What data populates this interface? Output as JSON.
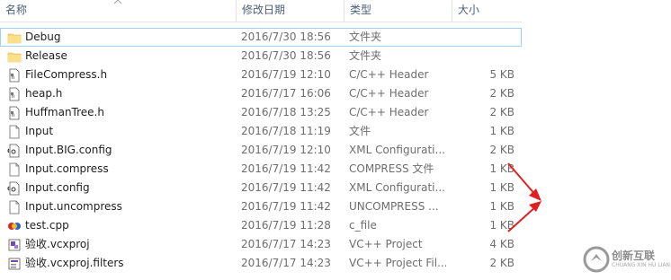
{
  "columns": {
    "name": "名称",
    "date": "修改日期",
    "type": "类型",
    "size": "大小"
  },
  "files": [
    {
      "name": "Debug",
      "date": "2016/7/30 18:56",
      "type": "文件夹",
      "size": "",
      "icon": "folder-icon"
    },
    {
      "name": "Release",
      "date": "2016/7/30 18:56",
      "type": "文件夹",
      "size": "",
      "icon": "folder-icon"
    },
    {
      "name": "FileCompress.h",
      "date": "2016/7/19 12:10",
      "type": "C/C++ Header",
      "size": "5 KB",
      "icon": "header-file-icon"
    },
    {
      "name": "heap.h",
      "date": "2016/7/17 16:06",
      "type": "C/C++ Header",
      "size": "2 KB",
      "icon": "header-file-icon"
    },
    {
      "name": "HuffmanTree.h",
      "date": "2016/7/18 13:25",
      "type": "C/C++ Header",
      "size": "2 KB",
      "icon": "header-file-icon"
    },
    {
      "name": "Input",
      "date": "2016/7/18 11:19",
      "type": "文件",
      "size": "1 KB",
      "icon": "blank-file-icon"
    },
    {
      "name": "Input.BIG.config",
      "date": "2016/7/19 12:10",
      "type": "XML Configurati...",
      "size": "2 KB",
      "icon": "config-file-icon"
    },
    {
      "name": "Input.compress",
      "date": "2016/7/19 11:42",
      "type": "COMPRESS 文件",
      "size": "1 KB",
      "icon": "blank-file-icon"
    },
    {
      "name": "Input.config",
      "date": "2016/7/19 11:42",
      "type": "XML Configurati...",
      "size": "1 KB",
      "icon": "config-file-icon"
    },
    {
      "name": "Input.uncompress",
      "date": "2016/7/19 11:42",
      "type": "UNCOMPRESS ...",
      "size": "1 KB",
      "icon": "blank-file-icon"
    },
    {
      "name": "test.cpp",
      "date": "2016/7/19 11:28",
      "type": "c_file",
      "size": "1 KB",
      "icon": "cpp-file-icon"
    },
    {
      "name": "验收.vcxproj",
      "date": "2016/7/17 14:23",
      "type": "VC++ Project",
      "size": "4 KB",
      "icon": "vcxproj-file-icon"
    },
    {
      "name": "验收.vcxproj.filters",
      "date": "2016/7/17 14:23",
      "type": "VC++ Project Fil...",
      "size": "2 KB",
      "icon": "filters-file-icon"
    }
  ],
  "watermark": {
    "text": "创新互联",
    "sub": "CHUANG XIN HU LIAN"
  },
  "colors": {
    "folder": "#f8d775",
    "arrow": "#e02020",
    "selection": "#99d1ff"
  }
}
